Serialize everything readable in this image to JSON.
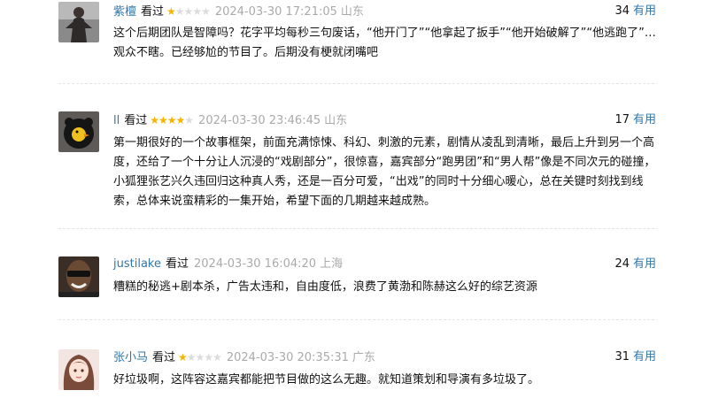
{
  "comments": [
    {
      "username": "紫檀",
      "status": "看过",
      "rating": 1,
      "time": "2024-03-30 17:21:05",
      "location": "山东",
      "votes": "34",
      "useful_label": "有用",
      "text": "这个后期团队是智障吗？花字平均每秒三句废话，“他开门了”“他拿起了扳手”“他开始破解了”“他逃跑了”…观众不瞎。已经够尬的节目了。后期没有梗就闭嘴吧",
      "avatar_icon": "dark-robed-person-avatar"
    },
    {
      "username": "ll",
      "status": "看过",
      "rating": 4,
      "time": "2024-03-30 23:46:45",
      "location": "山东",
      "votes": "17",
      "useful_label": "有用",
      "text": "第一期很好的一个故事框架，前面充满惊悚、科幻、刺激的元素，剧情从凌乱到清晰，最后上升到另一个高度，还给了一个十分让人沉浸的“戏剧部分”，很惊喜，嘉宾部分“跑男团”和“男人帮”像是不同次元的碰撞，小狐狸张艺兴久违回归这种真人秀，还是一百分可爱，“出戏”的同时十分细心暖心，总在关键时刻找到线索，总体来说蛮精彩的一集开始，希望下面的几期越来越成熟。",
      "avatar_icon": "black-cat-with-duck-avatar"
    },
    {
      "username": "justilake",
      "status": "看过",
      "rating": 0,
      "time": "2024-03-30 16:04:20",
      "location": "上海",
      "votes": "24",
      "useful_label": "有用",
      "text": "糟糕的秘逃+剧本杀，广告太违和，自由度低，浪费了黄渤和陈赫这么好的综艺资源",
      "avatar_icon": "man-with-sunglasses-avatar"
    },
    {
      "username": "张小马",
      "status": "看过",
      "rating": 1,
      "time": "2024-03-30 20:35:31",
      "location": "广东",
      "votes": "31",
      "useful_label": "有用",
      "text": "好垃圾啊，这阵容这嘉宾都能把节目做的这么无趣。就知道策划和导演有多垃圾了。",
      "avatar_icon": "anime-girl-avatar"
    }
  ]
}
